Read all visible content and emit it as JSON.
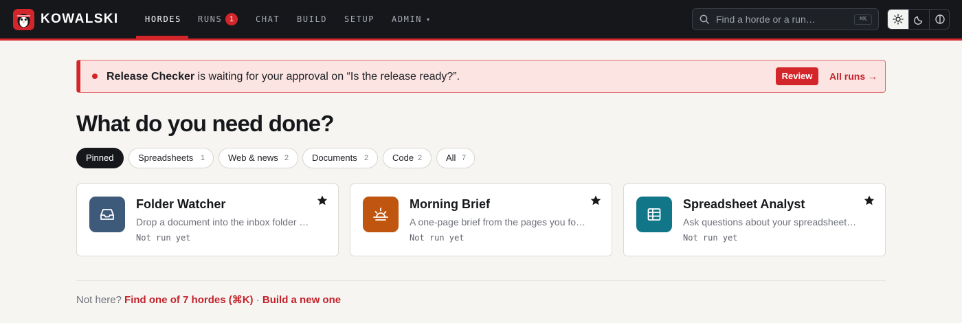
{
  "brand": {
    "name": "KOWALSKI",
    "logo_icon": "penguin-logo"
  },
  "nav": {
    "items": [
      {
        "label": "HORDES",
        "active": true
      },
      {
        "label": "RUNS",
        "badge": "1"
      },
      {
        "label": "CHAT"
      },
      {
        "label": "BUILD"
      },
      {
        "label": "SETUP"
      },
      {
        "label": "ADMIN",
        "caret": "▾"
      }
    ]
  },
  "search": {
    "placeholder": "Find a horde or a run…",
    "shortcut": "⌘K"
  },
  "theme": {
    "options": [
      "light",
      "dark",
      "contrast"
    ],
    "selected": "light"
  },
  "alert": {
    "name": "Release Checker",
    "message": " is waiting for your approval on “Is the release ready?”.",
    "review_label": "Review",
    "all_runs_label": "All runs →"
  },
  "title": "What do you need done?",
  "filters": [
    {
      "label": "Pinned",
      "count": "",
      "active": true
    },
    {
      "label": "Spreadsheets",
      "count": "1"
    },
    {
      "label": "Web & news",
      "count": "2"
    },
    {
      "label": "Documents",
      "count": "2"
    },
    {
      "label": "Code",
      "count": "2"
    },
    {
      "label": "All",
      "count": "7"
    }
  ],
  "cards": [
    {
      "title": "Folder Watcher",
      "description": "Drop a document into the inbox folder …",
      "status": "Not run yet",
      "icon": "inbox-icon",
      "color": "#3d5a7a",
      "pinned": true
    },
    {
      "title": "Morning Brief",
      "description": "A one-page brief from the pages you fo…",
      "status": "Not run yet",
      "icon": "sunrise-icon",
      "color": "#c05510",
      "pinned": true
    },
    {
      "title": "Spreadsheet Analyst",
      "description": "Ask questions about your spreadsheet…",
      "status": "Not run yet",
      "icon": "table-icon",
      "color": "#127689",
      "pinned": true
    }
  ],
  "footer": {
    "prefix": "Not here? ",
    "find_link": "Find one of 7 hordes (⌘K)",
    "separator": " · ",
    "build_link": "Build a new one"
  },
  "colors": {
    "accent": "#d3262b",
    "topbar": "#15171b",
    "background": "#f6f5f2"
  }
}
